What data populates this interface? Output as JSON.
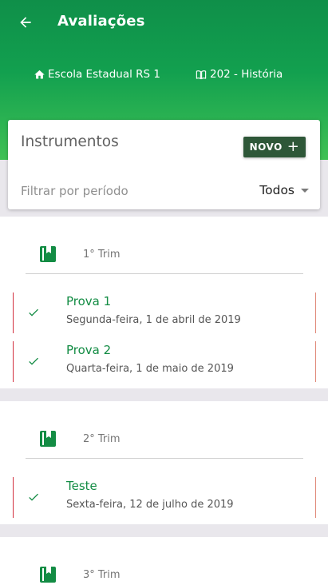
{
  "appbar": {
    "title": "Avaliações"
  },
  "context": {
    "school": "Escola Estadual RS 1",
    "class": "202 - História"
  },
  "instruments": {
    "title": "Instrumentos",
    "new_button": "NOVO",
    "new_button_icon": "+",
    "filter_label": "Filtrar por período",
    "filter_value": "Todos"
  },
  "sections": [
    {
      "label": "1° Trim",
      "items": [
        {
          "title": "Prova 1",
          "date": "Segunda-feira, 1 de abril de 2019"
        },
        {
          "title": "Prova 2",
          "date": "Quarta-feira, 1 de maio de 2019"
        }
      ]
    },
    {
      "label": "2° Trim",
      "items": [
        {
          "title": "Teste",
          "date": "Sexta-feira, 12 de julho de 2019"
        }
      ]
    },
    {
      "label": "3° Trim",
      "items": []
    }
  ],
  "colors": {
    "header_green": "#12a04f",
    "button_dark_green": "#2e5738",
    "item_title_green": "#138c44",
    "book_icon_green": "#138c44",
    "item_border_left": "#d32f3f"
  }
}
